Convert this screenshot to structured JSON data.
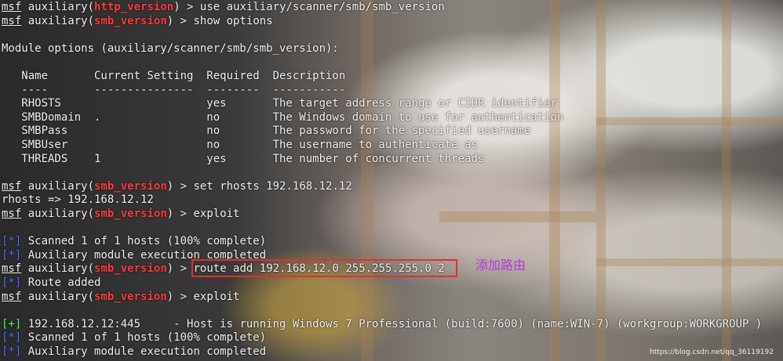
{
  "prompt": {
    "prefix": "msf",
    "module_type": "auxiliary",
    "separator": " > "
  },
  "lines": [
    {
      "mod": "http_version",
      "cmd": "use auxiliary/scanner/smb/smb_version"
    },
    {
      "mod": "smb_version",
      "cmd": "show options"
    },
    {
      "text": ""
    },
    {
      "text": "Module options (auxiliary/scanner/smb/smb_version):"
    },
    {
      "text": ""
    },
    {
      "text": "   Name       Current Setting  Required  Description"
    },
    {
      "text": "   ----       ---------------  --------  -----------"
    },
    {
      "text": "   RHOSTS                      yes       The target address range or CIDR identifier"
    },
    {
      "text": "   SMBDomain  .                no        The Windows domain to use for authentication"
    },
    {
      "text": "   SMBPass                     no        The password for the specified username"
    },
    {
      "text": "   SMBUser                     no        The username to authenticate as"
    },
    {
      "text": "   THREADS    1                yes       The number of concurrent threads"
    },
    {
      "text": ""
    },
    {
      "mod": "smb_version",
      "cmd": "set rhosts 192.168.12.12"
    },
    {
      "text": "rhosts => 192.168.12.12"
    },
    {
      "mod": "smb_version",
      "cmd": "exploit"
    },
    {
      "text": ""
    },
    {
      "status": "[*]",
      "color": "blue",
      "text": " Scanned 1 of 1 hosts (100% complete)"
    },
    {
      "status": "[*]",
      "color": "blue",
      "text": " Auxiliary module execution completed"
    },
    {
      "mod": "smb_version",
      "cmd": "route add 192.168.12.0 255.255.255.0 2"
    },
    {
      "status": "[*]",
      "color": "blue",
      "text": " Route added"
    },
    {
      "mod": "smb_version",
      "cmd": "exploit"
    },
    {
      "text": ""
    },
    {
      "status": "[+]",
      "color": "green",
      "text": " 192.168.12.12:445     - Host is running Windows 7 Professional (build:7600) (name:WIN-7) (workgroup:WORKGROUP )"
    },
    {
      "status": "[*]",
      "color": "blue",
      "text": " Scanned 1 of 1 hosts (100% complete)"
    },
    {
      "status": "[*]",
      "color": "blue",
      "text": " Auxiliary module execution completed"
    }
  ],
  "annotation": {
    "text": "添加路由",
    "color": "#b13ad8"
  },
  "highlight_color": "#e03030",
  "colors": {
    "module": "#ff3b3b",
    "status_blue": "#4c6fff",
    "status_green": "#4dff4d",
    "text": "#f2f2f2"
  },
  "watermark": "https://blog.csdn.net/qq_36119192"
}
